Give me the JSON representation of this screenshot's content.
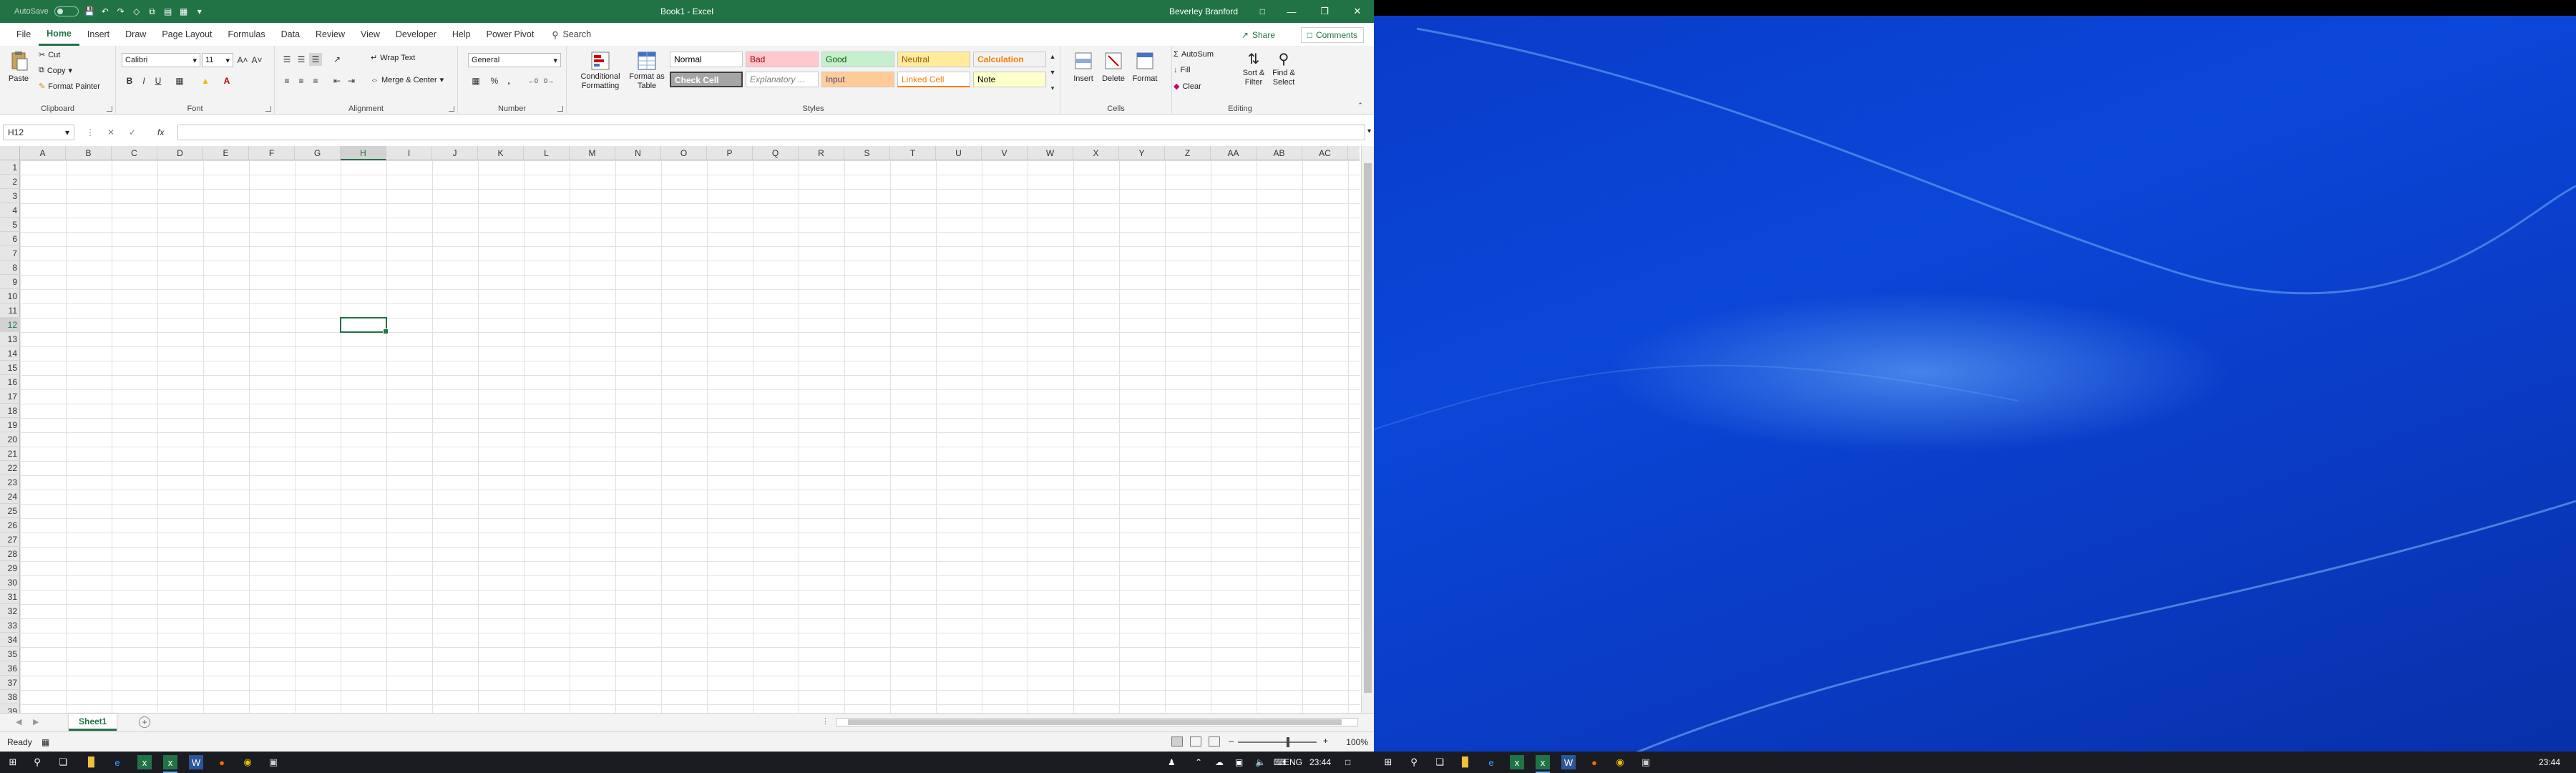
{
  "titlebar": {
    "autosave": "AutoSave",
    "title": "Book1 - Excel",
    "user": "Beverley Branford",
    "window_buttons": [
      "minimize",
      "restore",
      "close"
    ]
  },
  "tabs": [
    "File",
    "Home",
    "Insert",
    "Draw",
    "Page Layout",
    "Formulas",
    "Data",
    "Review",
    "View",
    "Developer",
    "Help",
    "Power Pivot"
  ],
  "active_tab": "Home",
  "search_label": "Search",
  "share_label": "Share",
  "comments_label": "Comments",
  "clipboard": {
    "paste": "Paste",
    "cut": "Cut",
    "copy": "Copy",
    "format_painter": "Format Painter",
    "label": "Clipboard"
  },
  "font": {
    "name": "Calibri",
    "size": "11",
    "label": "Font",
    "bold": "B",
    "italic": "I",
    "underline": "U"
  },
  "alignment": {
    "wrap": "Wrap Text",
    "merge": "Merge & Center",
    "label": "Alignment"
  },
  "number": {
    "format": "General",
    "label": "Number",
    "percent": "%",
    "comma": ","
  },
  "styles": {
    "cond_l1": "Conditional",
    "cond_l2": "Formatting",
    "table_l1": "Format as",
    "table_l2": "Table",
    "label": "Styles",
    "cells": [
      {
        "text": "Normal",
        "bg": "#ffffff",
        "fg": "#000000"
      },
      {
        "text": "Bad",
        "bg": "#ffc7ce",
        "fg": "#9c0006"
      },
      {
        "text": "Good",
        "bg": "#c6efce",
        "fg": "#006100"
      },
      {
        "text": "Neutral",
        "bg": "#ffeb9c",
        "fg": "#9c5700"
      },
      {
        "text": "Calculation",
        "bg": "#f2f2f2",
        "fg": "#fa7d00"
      },
      {
        "text": "Check Cell",
        "bg": "#a5a5a5",
        "fg": "#ffffff"
      },
      {
        "text": "Explanatory ...",
        "bg": "#ffffff",
        "fg": "#7f7f7f"
      },
      {
        "text": "Input",
        "bg": "#ffcc99",
        "fg": "#3f3f76"
      },
      {
        "text": "Linked Cell",
        "bg": "#ffffff",
        "fg": "#fa7d00"
      },
      {
        "text": "Note",
        "bg": "#ffffcc",
        "fg": "#000000"
      }
    ]
  },
  "cells_group": {
    "insert": "Insert",
    "delete": "Delete",
    "format": "Format",
    "label": "Cells"
  },
  "editing": {
    "autosum": "AutoSum",
    "fill": "Fill",
    "clear": "Clear",
    "sort_l1": "Sort &",
    "sort_l2": "Filter",
    "find_l1": "Find &",
    "find_l2": "Select",
    "label": "Editing"
  },
  "formula": {
    "namebox": "H12",
    "fx": "fx",
    "value": ""
  },
  "columns": [
    "A",
    "B",
    "C",
    "D",
    "E",
    "F",
    "G",
    "H",
    "I",
    "J",
    "K",
    "L",
    "M",
    "N",
    "O",
    "P",
    "Q",
    "R",
    "S",
    "T",
    "U",
    "V",
    "W",
    "X",
    "Y",
    "Z",
    "AA",
    "AB",
    "AC"
  ],
  "rows": [
    "1",
    "2",
    "3",
    "4",
    "5",
    "6",
    "7",
    "8",
    "9",
    "10",
    "11",
    "12",
    "13",
    "14",
    "15",
    "16",
    "17",
    "18",
    "19",
    "20",
    "21",
    "22",
    "23",
    "24",
    "25",
    "26",
    "27",
    "28",
    "29",
    "30",
    "31",
    "32",
    "33",
    "34",
    "35",
    "36",
    "37",
    "38",
    "39"
  ],
  "selected": {
    "col": "H",
    "row": "12"
  },
  "sheet_tab": "Sheet1",
  "status": "Ready",
  "zoom": "100%",
  "taskbar_right": {
    "lang": "ENG",
    "time": "23:44"
  },
  "desktop_clock": "23:44"
}
